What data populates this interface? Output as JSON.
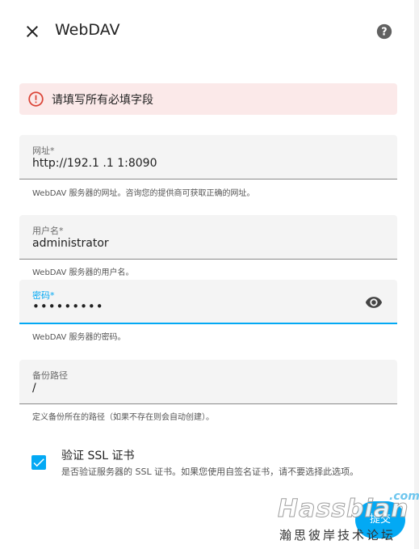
{
  "dialog": {
    "title": "WebDAV"
  },
  "alert": {
    "text": "请填写所有必填字段"
  },
  "fields": {
    "url": {
      "label": "网址*",
      "value": "http://192.1   .1   1:8090",
      "helper": "WebDAV 服务器的网址。咨询您的提供商可获取正确的网址。"
    },
    "username": {
      "label": "用户名*",
      "value": "administrator",
      "helper": "WebDAV 服务器的用户名。"
    },
    "password": {
      "label": "密码*",
      "value": "•••••••••",
      "helper": "WebDAV 服务器的密码。"
    },
    "backup_path": {
      "label": "备份路径",
      "value": "/",
      "helper": "定义备份所在的路径（如果不存在则会自动创建）。"
    }
  },
  "ssl": {
    "checked": true,
    "label": "验证 SSL 证书",
    "description": "是否验证服务器的 SSL 证书。如果您使用自签名证书，请不要选择此选项。"
  },
  "actions": {
    "submit_label": "提交"
  },
  "watermark": {
    "com": ".com",
    "main": "Hassbian",
    "sub": "瀚思彼岸技术论坛"
  },
  "colors": {
    "accent": "#03a9f4",
    "error": "#db4437",
    "alert_bg": "#fbe9e9"
  }
}
